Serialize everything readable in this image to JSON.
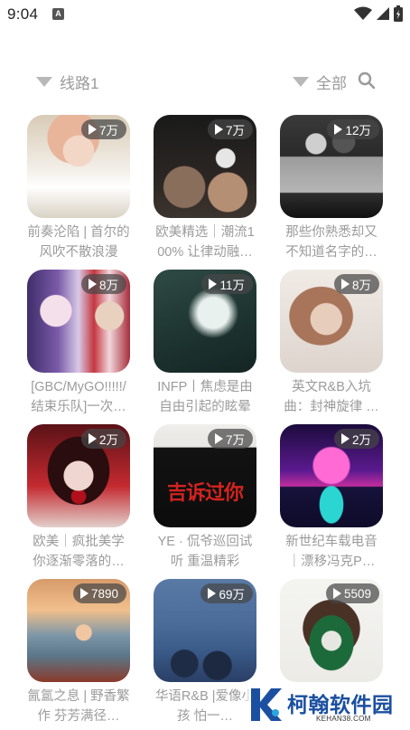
{
  "status": {
    "time": "9:04",
    "notif_icon": "A"
  },
  "filters": {
    "route_label": "线路1",
    "category_label": "全部"
  },
  "cards": [
    {
      "count": "7万",
      "title": "前奏沦陷 | 首尔的风吹不散浪漫",
      "theme": "girl-white"
    },
    {
      "count": "7万",
      "title": "欧美精选｜潮流100% 让律动融…",
      "theme": "group-dark"
    },
    {
      "count": "12万",
      "title": "那些你熟悉却又不知道名字的…",
      "theme": "bw-book"
    },
    {
      "count": "8万",
      "title": "[GBC/MyGO!!!!!/结束乐队]一次…",
      "theme": "anime"
    },
    {
      "count": "11万",
      "title": "INFP丨焦虑是由自由引起的眩晕",
      "theme": "butterfly"
    },
    {
      "count": "8万",
      "title": "英文R&B入坑曲：封神旋律 …",
      "theme": "portrait-bw"
    },
    {
      "count": "2万",
      "title": "欧美｜疯批美学 你逐渐零落的…",
      "theme": "red-face"
    },
    {
      "count": "7万",
      "title": "YE · 侃爷巡回试听 重温精彩",
      "theme": "hoodie"
    },
    {
      "count": "2万",
      "title": "新世纪车载电音｜漂移冯克P…",
      "theme": "synthwave"
    },
    {
      "count": "7890",
      "title": "氤氲之息 | 野香繁作 芬芳满径…",
      "theme": "sunset"
    },
    {
      "count": "69万",
      "title": "华语R&B |爱像小孩 怕一…",
      "theme": "sea"
    },
    {
      "count": "5509",
      "title": "",
      "theme": "bandana"
    }
  ],
  "watermark": {
    "name": "柯翰软件园",
    "domain": "KEHAN38.COM"
  }
}
